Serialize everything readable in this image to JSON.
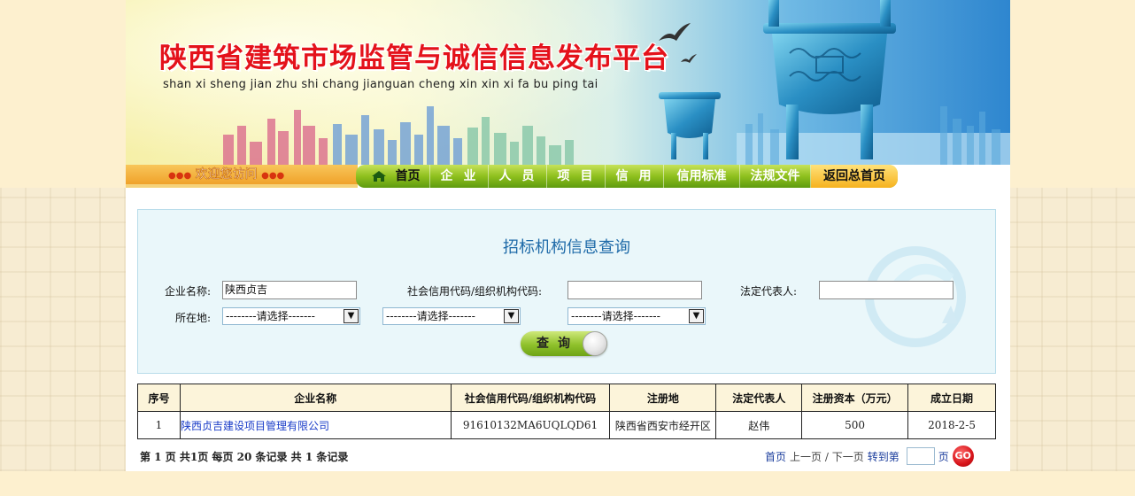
{
  "banner": {
    "title": "陕西省建筑市场监管与诚信信息发布平台",
    "subtitle": "shan xi sheng jian zhu shi chang jianguan cheng xin xin xi fa bu ping tai"
  },
  "welcome": {
    "dots_left": "●●●",
    "text": "欢迎您访问",
    "dots_right": "●●●"
  },
  "nav": {
    "items": [
      "首页",
      "企业",
      "人员",
      "项目",
      "信用",
      "信用标准",
      "法规文件",
      "返回总首页"
    ]
  },
  "query": {
    "title": "招标机构信息查询",
    "company_label": "企业名称:",
    "company_value": "陕西贞吉",
    "credit_code_label": "社会信用代码/组织机构代码:",
    "credit_code_value": "",
    "legal_rep_label": "法定代表人:",
    "legal_rep_value": "",
    "location_label": "所在地:",
    "select_placeholder": "--------请选择-------",
    "select_1": "--------请选择-------",
    "select_2": "--------请选择-------",
    "select_3": "--------请选择-------",
    "button_label": "查询"
  },
  "table": {
    "headers": [
      "序号",
      "企业名称",
      "社会信用代码/组织机构代码",
      "注册地",
      "法定代表人",
      "注册资本（万元）",
      "成立日期"
    ],
    "rows": [
      [
        "1",
        "陕西贞吉建设项目管理有限公司",
        "91610132MA6UQLQD61",
        "陕西省西安市经开区",
        "赵伟",
        "500",
        "2018-2-5"
      ]
    ]
  },
  "pager": {
    "info": "第 1 页 共1页 每页 20 条记录 共 1 条记录",
    "first": "首页",
    "prev_next": "上一页 / 下一页",
    "goto": "转到第",
    "page_unit": "页",
    "go": "GO"
  },
  "colors": {
    "title_red": "#e4121b",
    "nav_green": "#8fc01e",
    "panel_bg": "#eaf7fa",
    "link_blue": "#1a3cc8"
  }
}
